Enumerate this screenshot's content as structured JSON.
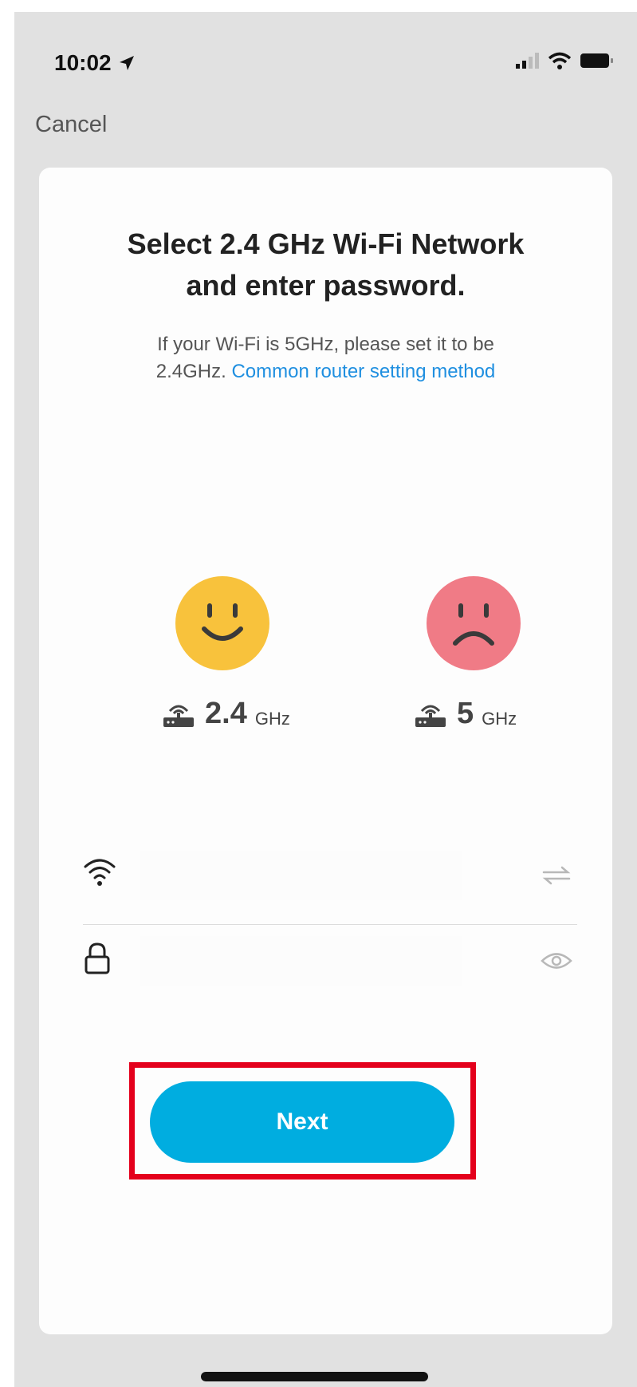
{
  "status_bar": {
    "time": "10:02"
  },
  "nav": {
    "cancel_label": "Cancel"
  },
  "card": {
    "title_line1": "Select 2.4 GHz Wi-Fi Network",
    "title_line2": "and enter password.",
    "subtitle_line1": "If your Wi-Fi is 5GHz, please set it to be",
    "subtitle_prefix": "2.4GHz.",
    "subtitle_link": "Common router setting method"
  },
  "bands": [
    {
      "value": "2.4",
      "unit": "GHz",
      "mood": "happy",
      "color": "#f8c23c"
    },
    {
      "value": "5",
      "unit": "GHz",
      "mood": "sad",
      "color": "#f07b86"
    }
  ],
  "form": {
    "wifi_value": "",
    "password_value": ""
  },
  "actions": {
    "next_label": "Next"
  },
  "colors": {
    "accent": "#00ade0",
    "link": "#1f8fe0",
    "highlight": "#e4001c"
  }
}
